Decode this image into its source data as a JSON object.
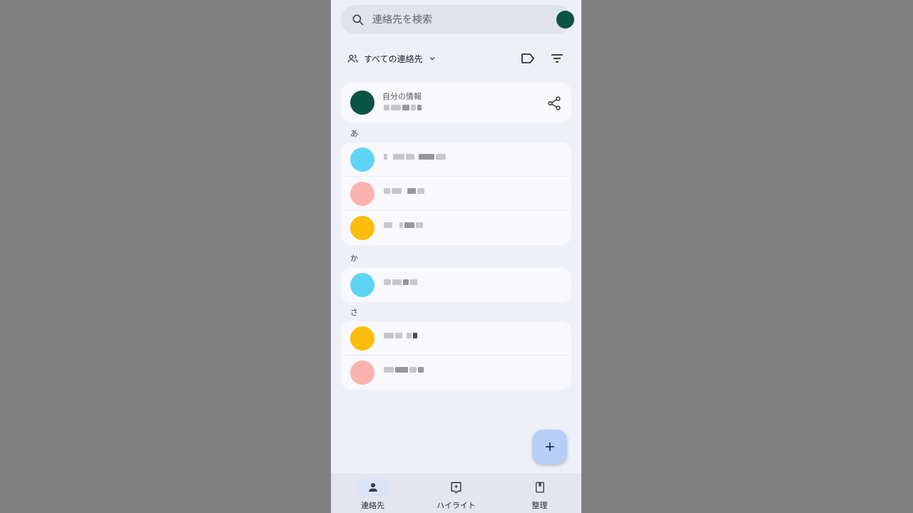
{
  "search": {
    "placeholder": "連絡先を検索"
  },
  "toolbar": {
    "filter_label": "すべての連絡先"
  },
  "my_info": {
    "label": "自分の情報"
  },
  "sections": [
    {
      "header": "あ",
      "contacts": [
        {
          "avatar_color": "#5fd5f5"
        },
        {
          "avatar_color": "#f9b2ad"
        },
        {
          "avatar_color": "#fbbd0a"
        }
      ]
    },
    {
      "header": "か",
      "contacts": [
        {
          "avatar_color": "#5fd5f5"
        }
      ]
    },
    {
      "header": "さ",
      "contacts": [
        {
          "avatar_color": "#fbbd0a"
        },
        {
          "avatar_color": "#f9b2ad"
        }
      ]
    }
  ],
  "bottom_nav": [
    {
      "label": "連絡先",
      "icon": "person-icon",
      "active": true
    },
    {
      "label": "ハイライト",
      "icon": "highlight-icon",
      "active": false
    },
    {
      "label": "整理",
      "icon": "bookmark-icon",
      "active": false
    }
  ],
  "colors": {
    "account": "#0b5345",
    "fab": "#b7cef8"
  }
}
